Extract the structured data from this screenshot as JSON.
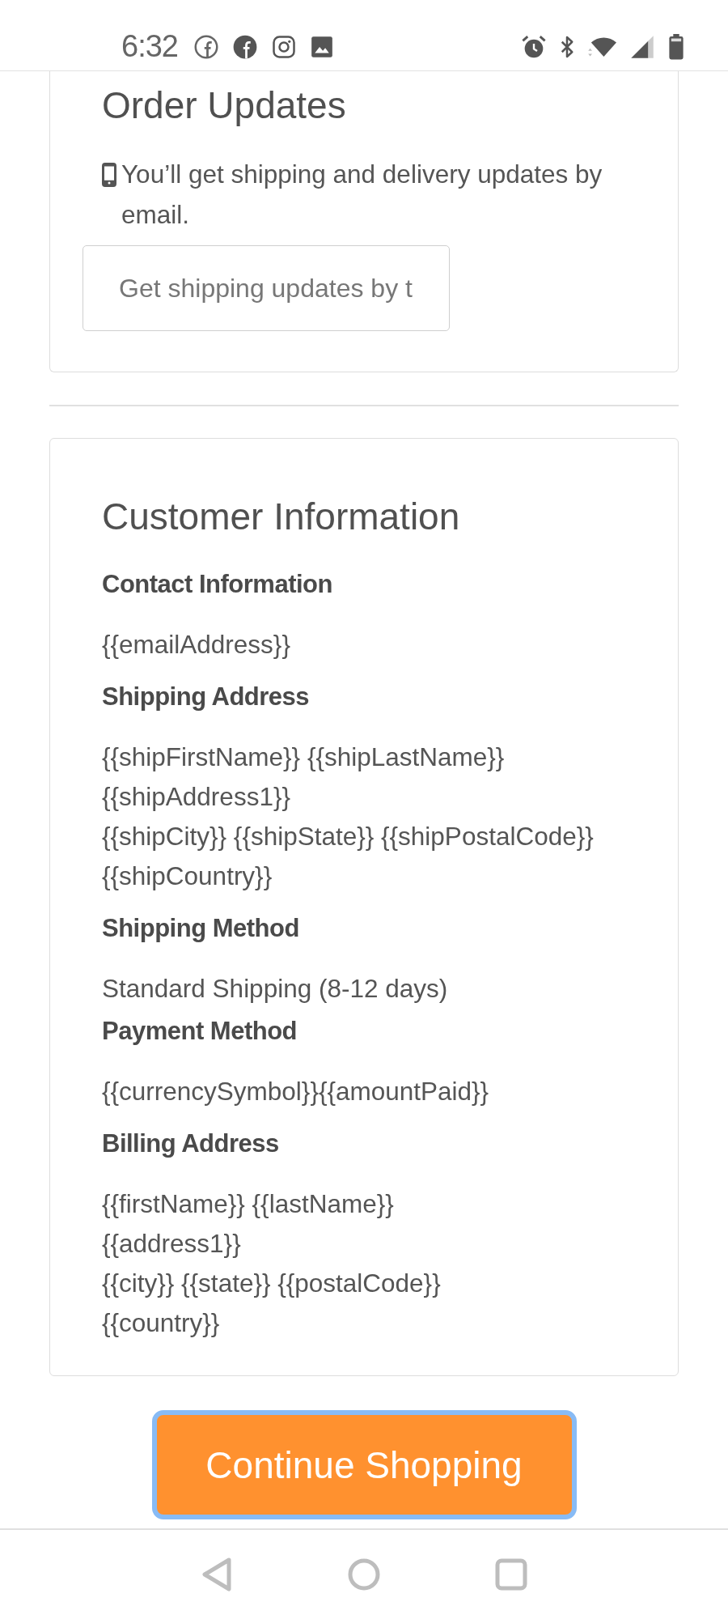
{
  "status_bar": {
    "time": "6:32"
  },
  "order_updates": {
    "title": "Order Updates",
    "message": "You’ll get shipping and delivery updates by email.",
    "updates_field": {
      "placeholder": "Get shipping updates by t"
    }
  },
  "customer_information": {
    "title": "Customer Information",
    "sections": [
      {
        "kind": "lines",
        "heading": "Contact Information",
        "lines": [
          "{{emailAddress}}"
        ]
      },
      {
        "kind": "lines",
        "heading": "Shipping Address",
        "lines": [
          "{{shipFirstName}} {{shipLastName}}",
          "{{shipAddress1}}",
          "{{shipCity}} {{shipState}} {{shipPostalCode}}",
          "{{shipCountry}}"
        ]
      },
      {
        "kind": "text",
        "heading": "Shipping Method",
        "lines": [
          "Standard Shipping (8-12 days)"
        ]
      },
      {
        "kind": "lines",
        "heading": "Payment Method",
        "lines": [
          "{{currencySymbol}}{{amountPaid}}"
        ]
      },
      {
        "kind": "lines",
        "heading": "Billing Address",
        "lines": [
          "{{firstName}} {{lastName}}",
          "{{address1}}",
          "{{city}} {{state}} {{postalCode}}",
          "{{country}}"
        ]
      }
    ]
  },
  "continue_button": {
    "label": "Continue Shopping",
    "focused": true
  }
}
